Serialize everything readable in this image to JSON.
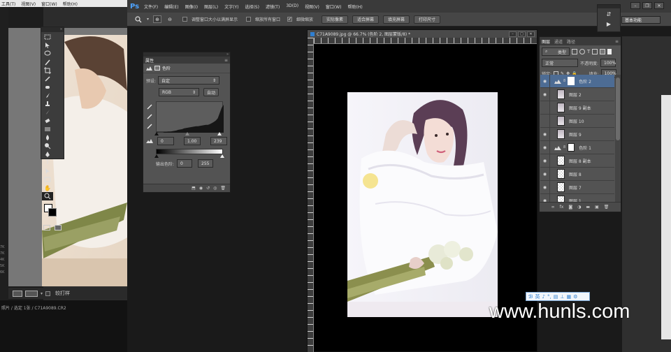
{
  "left_app": {
    "menu": [
      "工具(T)",
      "视图(V)",
      "窗口(W)",
      "帮助(H)"
    ],
    "bottom_label": "较打样",
    "status_text": "照片 / 选定 1张 / C71A9089.CR2",
    "side_numbers": [
      "7K",
      "7K",
      "4K",
      "5K",
      "6K"
    ]
  },
  "ps": {
    "logo": "Ps",
    "menu": [
      "文件(F)",
      "编辑(E)",
      "图像(I)",
      "图层(L)",
      "文字(Y)",
      "选择(S)",
      "滤镜(T)",
      "3D(D)",
      "视图(V)",
      "窗口(W)",
      "帮助(H)"
    ],
    "options": {
      "resize_label": "调整窗口大小以满屏显示",
      "zoom_all_label": "缩放所有窗口",
      "scrubby_label": "细微缩放",
      "btn_actual": "实际像素",
      "btn_fit": "适合屏幕",
      "btn_fill": "填充屏幕",
      "btn_print": "打印尺寸"
    },
    "workspace": "基本功能",
    "doc_tab": "C71A9089.jpg @ 66.7% (色阶 2, 图层蒙版/8) *"
  },
  "properties": {
    "title": "属性",
    "header_label": "色阶",
    "preset_label": "预设:",
    "preset_value": "自定",
    "channel_value": "RGB",
    "auto_label": "自动",
    "input_black": "0",
    "input_gamma": "1.00",
    "input_white": "239",
    "output_label": "输出色阶:",
    "output_black": "0",
    "output_white": "255",
    "histogram": [
      2,
      1,
      1,
      1,
      2,
      2,
      3,
      3,
      4,
      5,
      6,
      8,
      9,
      10,
      12,
      13,
      14,
      15,
      16,
      17,
      18,
      18,
      19,
      20,
      21,
      22,
      22,
      24,
      27,
      30,
      34,
      40,
      55,
      70,
      78
    ]
  },
  "layers": {
    "tabs": [
      "图层",
      "通道",
      "路径"
    ],
    "kind_label": "类型",
    "blend_mode": "正常",
    "opacity_label": "不透明度:",
    "opacity_value": "100%",
    "lock_label": "锁定:",
    "fill_label": "填充:",
    "fill_value": "100%",
    "items": [
      {
        "name": "色阶 2",
        "type": "adjust",
        "selected": true,
        "visible": true
      },
      {
        "name": "图层 2",
        "type": "pixel",
        "selected": false,
        "visible": true
      },
      {
        "name": "图层 9 副本",
        "type": "pixel",
        "selected": false,
        "visible": false
      },
      {
        "name": "图层 10",
        "type": "pixel",
        "selected": false,
        "visible": false
      },
      {
        "name": "图层 9",
        "type": "pixel",
        "selected": false,
        "visible": true
      },
      {
        "name": "色阶 1",
        "type": "adjust",
        "selected": false,
        "visible": true
      },
      {
        "name": "图层 8 副本",
        "type": "trans",
        "selected": false,
        "visible": true
      },
      {
        "name": "图层 8",
        "type": "trans",
        "selected": false,
        "visible": true
      },
      {
        "name": "图层 7",
        "type": "trans",
        "selected": false,
        "visible": true
      },
      {
        "name": "图层 1",
        "type": "trans",
        "selected": false,
        "visible": true
      }
    ]
  },
  "ime_bar": {
    "items": [
      "英",
      "♪",
      "°,",
      "▤",
      "⊥",
      "▦",
      "⚙"
    ]
  },
  "watermark": "www.hunls.com",
  "colors": {
    "accent": "#2f7fd1",
    "panel": "#535353",
    "dark": "#3a3a3a"
  }
}
